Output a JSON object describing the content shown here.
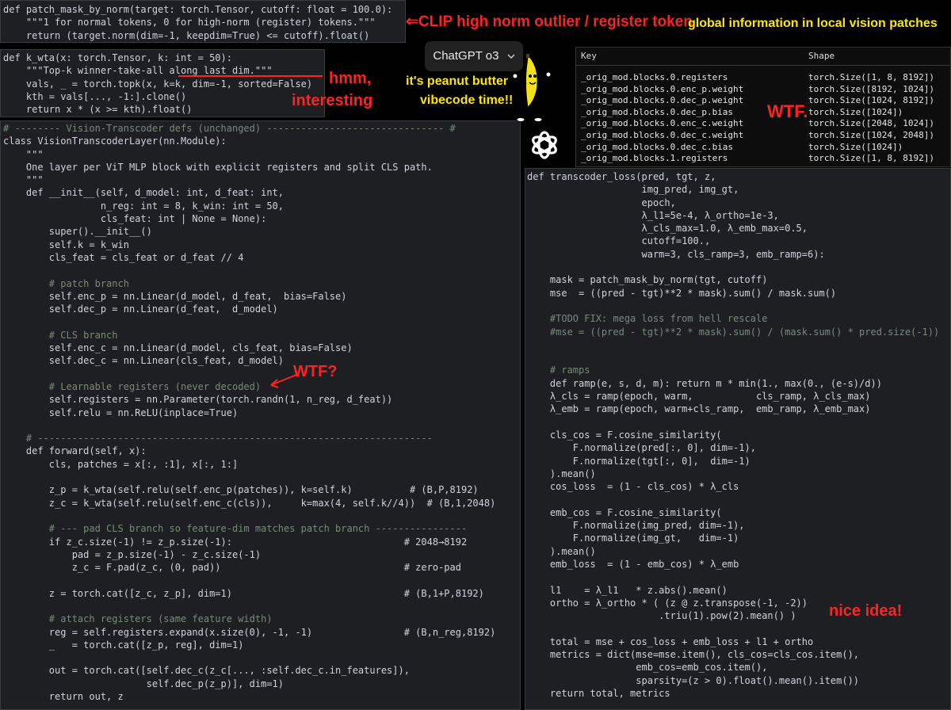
{
  "annotations": {
    "clip": "⇐CLIP high norm outlier / register token",
    "global": "global information in local vision patches",
    "hmm_1": "hmm,",
    "hmm_2": "interesting",
    "peanut_1": "it's peanut butter",
    "peanut_2": "vibecode time!!",
    "wtf_table": "WTF.",
    "wtf_code": "WTF?",
    "nice": "nice idea!"
  },
  "chatgpt": {
    "model_label": "ChatGPT o3",
    "chevron": "chevron-down-icon"
  },
  "colors": {
    "annotation_red": "#ff2222",
    "annotation_yellow": "#ffe600",
    "editor_bg": "#1e1f22"
  },
  "table": {
    "headers": [
      "Key",
      "Shape"
    ],
    "rows": [
      {
        "key": "_orig_mod.blocks.0.registers",
        "shape": "torch.Size([1, 8, 8192])"
      },
      {
        "key": "_orig_mod.blocks.0.enc_p.weight",
        "shape": "torch.Size([8192, 1024])"
      },
      {
        "key": "_orig_mod.blocks.0.dec_p.weight",
        "shape": "torch.Size([1024, 8192])"
      },
      {
        "key": "_orig_mod.blocks.0.dec_p.bias",
        "shape": "torch.Size([1024])"
      },
      {
        "key": "_orig_mod.blocks.0.enc_c.weight",
        "shape": "torch.Size([2048, 1024])"
      },
      {
        "key": "_orig_mod.blocks.0.dec_c.weight",
        "shape": "torch.Size([1024, 2048])"
      },
      {
        "key": "_orig_mod.blocks.0.dec_c.bias",
        "shape": "torch.Size([1024])"
      },
      {
        "key": "_orig_mod.blocks.1.registers",
        "shape": "torch.Size([1, 8, 8192])"
      }
    ]
  },
  "code_mask": [
    "def patch_mask_by_norm(target: torch.Tensor, cutoff: float = 100.0):",
    "    \"\"\"1 for normal tokens, 0 for high-norm (register) tokens.\"\"\"",
    "    return (target.norm(dim=-1, keepdim=True) <= cutoff).float()"
  ],
  "code_kwta": [
    "def k_wta(x: torch.Tensor, k: int = 50):",
    "    \"\"\"Top-k winner-take-all along last dim.\"\"\"",
    "    vals, _ = torch.topk(x, k=k, dim=-1, sorted=False)",
    "    kth = vals[..., -1:].clone()",
    "    return x * (x >= kth).float()"
  ],
  "code_layer": [
    "# -------- Vision-Transcoder defs (unchanged) ------------------------------- #",
    "class VisionTranscoderLayer(nn.Module):",
    "    \"\"\"",
    "    One layer per ViT MLP block with explicit registers and split CLS path.",
    "    \"\"\"",
    "    def __init__(self, d_model: int, d_feat: int,",
    "                 n_reg: int = 8, k_win: int = 50,",
    "                 cls_feat: int | None = None):",
    "        super().__init__()",
    "        self.k = k_win",
    "        cls_feat = cls_feat or d_feat // 4",
    "",
    "        # patch branch",
    "        self.enc_p = nn.Linear(d_model, d_feat,  bias=False)",
    "        self.dec_p = nn.Linear(d_feat,  d_model)",
    "",
    "        # CLS branch",
    "        self.enc_c = nn.Linear(d_model, cls_feat, bias=False)",
    "        self.dec_c = nn.Linear(cls_feat, d_model)",
    "",
    "        # Learnable registers (never decoded)",
    "        self.registers = nn.Parameter(torch.randn(1, n_reg, d_feat))",
    "        self.relu = nn.ReLU(inplace=True)",
    "",
    "    # ---------------------------------------------------------------------",
    "    def forward(self, x):",
    "        cls, patches = x[:, :1], x[:, 1:]",
    "",
    "        z_p = k_wta(self.relu(self.enc_p(patches)), k=self.k)          # (B,P,8192)",
    "        z_c = k_wta(self.relu(self.enc_c(cls)),     k=max(4, self.k//4))  # (B,1,2048)",
    "",
    "        # --- pad CLS branch so feature-dim matches patch branch ----------------",
    "        if z_c.size(-1) != z_p.size(-1):                              # 2048→8192",
    "            pad = z_p.size(-1) - z_c.size(-1)",
    "            z_c = F.pad(z_c, (0, pad))                                # zero-pad",
    "",
    "        z = torch.cat([z_c, z_p], dim=1)                              # (B,1+P,8192)",
    "",
    "        # attach registers (same feature width)",
    "        reg = self.registers.expand(x.size(0), -1, -1)                # (B,n_reg,8192)",
    "        _   = torch.cat([z_p, reg], dim=1)",
    "",
    "        out = torch.cat([self.dec_c(z_c[..., :self.dec_c.in_features]),",
    "                         self.dec_p(z_p)], dim=1)",
    "        return out, z"
  ],
  "code_loss": [
    "def transcoder_loss(pred, tgt, z,",
    "                    img_pred, img_gt,",
    "                    epoch,",
    "                    λ_l1=5e-4, λ_ortho=1e-3,",
    "                    λ_cls_max=1.0, λ_emb_max=0.5,",
    "                    cutoff=100.,",
    "                    warm=3, cls_ramp=3, emb_ramp=6):",
    "",
    "    mask = patch_mask_by_norm(tgt, cutoff)",
    "    mse  = ((pred - tgt)**2 * mask).sum() / mask.sum()",
    "",
    "    #TODO FIX: mega loss from hell rescale",
    "    #mse = ((pred - tgt)**2 * mask).sum() / (mask.sum() * pred.size(-1))",
    "",
    "",
    "    # ramps",
    "    def ramp(e, s, d, m): return m * min(1., max(0., (e-s)/d))",
    "    λ_cls = ramp(epoch, warm,           cls_ramp, λ_cls_max)",
    "    λ_emb = ramp(epoch, warm+cls_ramp,  emb_ramp, λ_emb_max)",
    "",
    "    cls_cos = F.cosine_similarity(",
    "        F.normalize(pred[:, 0], dim=-1),",
    "        F.normalize(tgt[:, 0],  dim=-1)",
    "    ).mean()",
    "    cos_loss  = (1 - cls_cos) * λ_cls",
    "",
    "    emb_cos = F.cosine_similarity(",
    "        F.normalize(img_pred, dim=-1),",
    "        F.normalize(img_gt,   dim=-1)",
    "    ).mean()",
    "    emb_loss  = (1 - emb_cos) * λ_emb",
    "",
    "    l1    = λ_l1   * z.abs().mean()",
    "    ortho = λ_ortho * ( (z @ z.transpose(-1, -2))",
    "                       .triu(1).pow(2).mean() )",
    "",
    "    total = mse + cos_loss + emb_loss + l1 + ortho",
    "    metrics = dict(mse=mse.item(), cls_cos=cls_cos.item(),",
    "                   emb_cos=emb_cos.item(),",
    "                   sparsity=(z > 0).float().mean().item())",
    "    return total, metrics"
  ]
}
